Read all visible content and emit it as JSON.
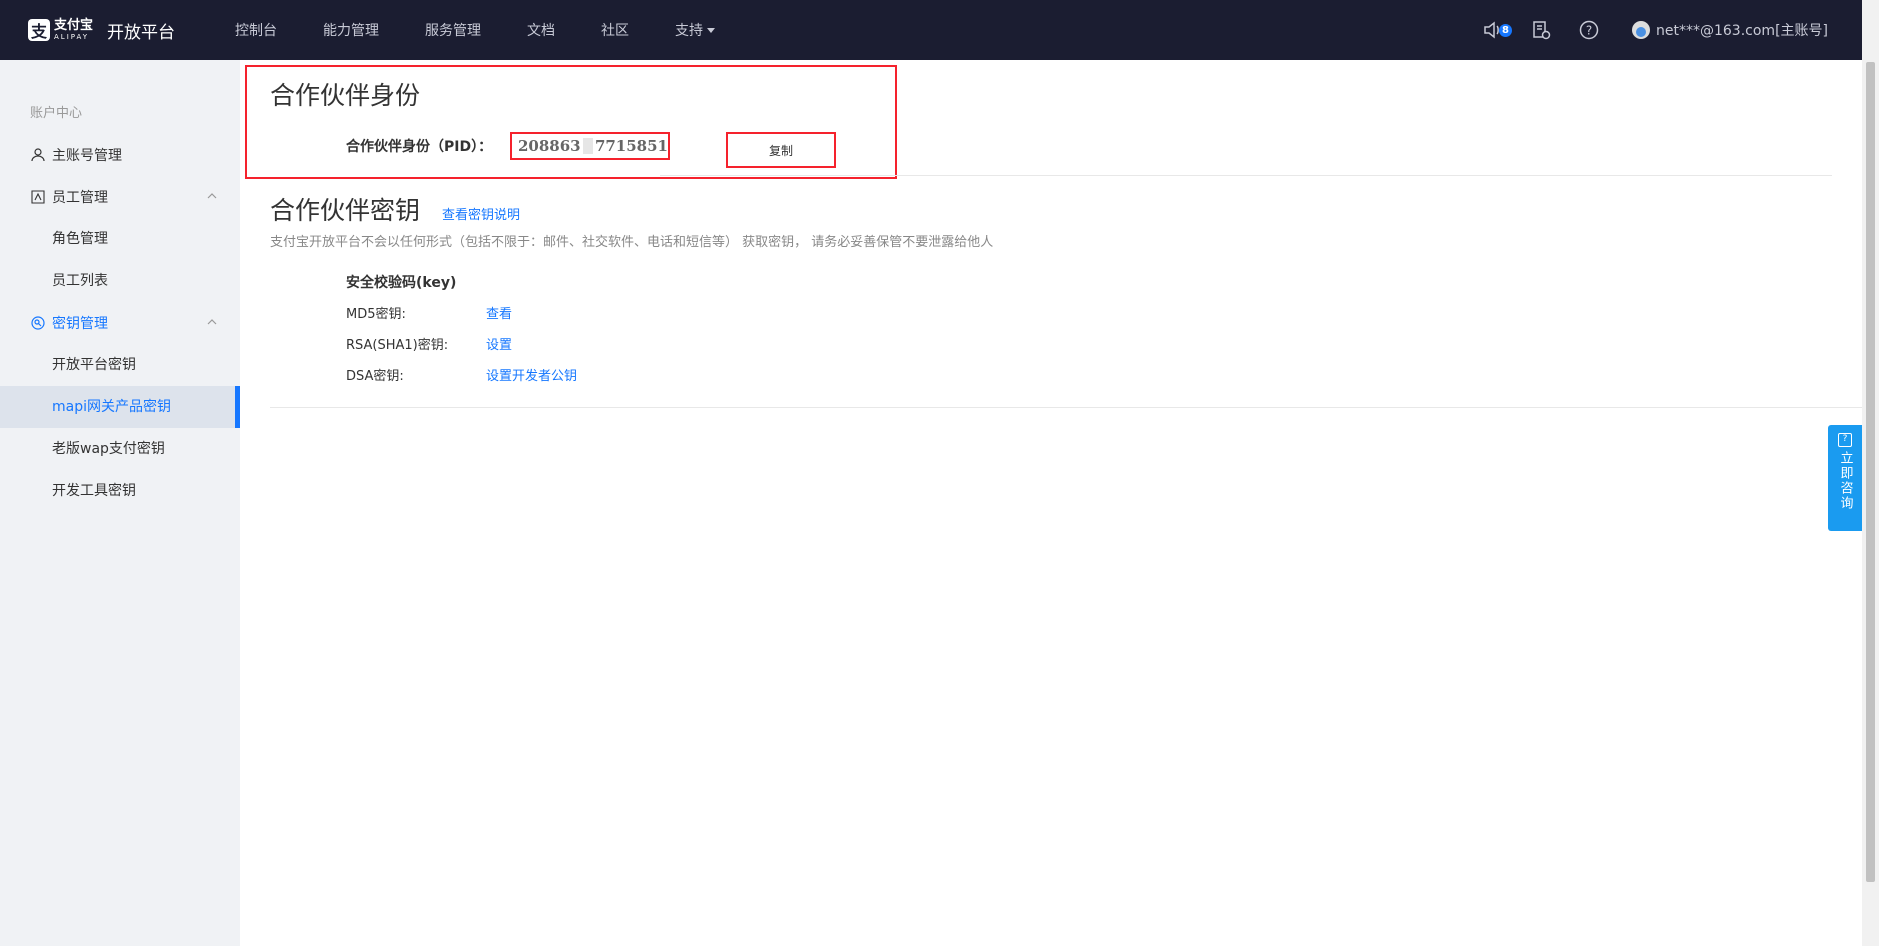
{
  "header": {
    "logo_cn": "支付宝",
    "logo_en": "ALIPAY",
    "platform": "开放平台",
    "nav": [
      "控制台",
      "能力管理",
      "服务管理",
      "文档",
      "社区",
      "支持"
    ],
    "notification_count": "8",
    "account": "net***@163.com[主账号]"
  },
  "sidebar": {
    "title": "账户中心",
    "main_account": "主账号管理",
    "staff_group": "员工管理",
    "staff_items": [
      "角色管理",
      "员工列表"
    ],
    "key_group": "密钥管理",
    "key_items": [
      "开放平台密钥",
      "mapi网关产品密钥",
      "老版wap支付密钥",
      "开发工具密钥"
    ]
  },
  "partner_identity": {
    "title": "合作伙伴身份",
    "pid_label": "合作伙伴身份（PID）：",
    "pid_prefix": "208863",
    "pid_suffix": "7715851",
    "copy_button": "复制"
  },
  "partner_key": {
    "title": "合作伙伴密钥",
    "doc_link": "查看密钥说明",
    "note": "支付宝开放平台不会以任何形式（包括不限于：邮件、社交软件、电话和短信等） 获取密钥， 请务必妥善保管不要泄露给他人",
    "key_title": "安全校验码(key)",
    "rows": [
      {
        "label": "MD5密钥:",
        "action": "查看"
      },
      {
        "label": "RSA(SHA1)密钥:",
        "action": "设置"
      },
      {
        "label": "DSA密钥:",
        "action": "设置开发者公钥"
      }
    ]
  },
  "float_help": "立即咨询",
  "colors": {
    "accent": "#1677ff",
    "topbar": "#1b1d31",
    "highlight": "#f5222d"
  }
}
